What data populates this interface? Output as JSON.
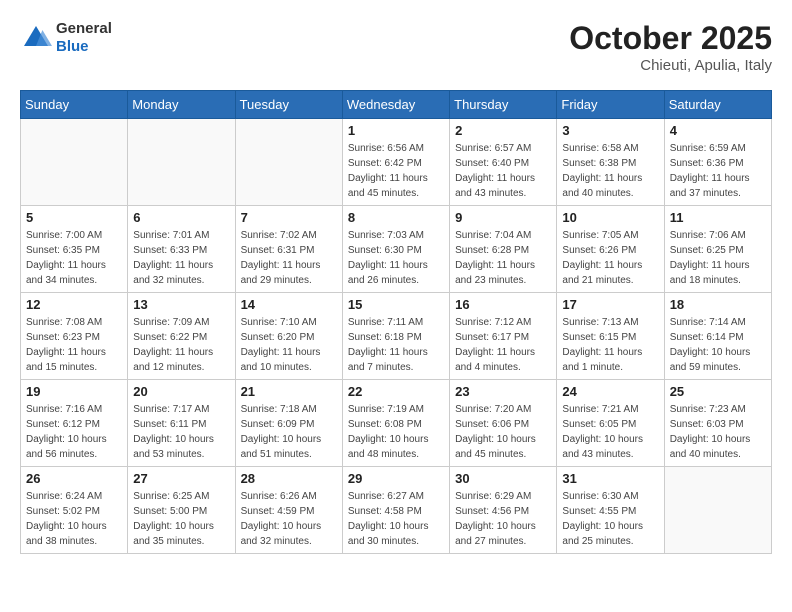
{
  "header": {
    "logo_general": "General",
    "logo_blue": "Blue",
    "month_year": "October 2025",
    "location": "Chieuti, Apulia, Italy"
  },
  "weekdays": [
    "Sunday",
    "Monday",
    "Tuesday",
    "Wednesday",
    "Thursday",
    "Friday",
    "Saturday"
  ],
  "weeks": [
    [
      {
        "day": "",
        "info": ""
      },
      {
        "day": "",
        "info": ""
      },
      {
        "day": "",
        "info": ""
      },
      {
        "day": "1",
        "info": "Sunrise: 6:56 AM\nSunset: 6:42 PM\nDaylight: 11 hours\nand 45 minutes."
      },
      {
        "day": "2",
        "info": "Sunrise: 6:57 AM\nSunset: 6:40 PM\nDaylight: 11 hours\nand 43 minutes."
      },
      {
        "day": "3",
        "info": "Sunrise: 6:58 AM\nSunset: 6:38 PM\nDaylight: 11 hours\nand 40 minutes."
      },
      {
        "day": "4",
        "info": "Sunrise: 6:59 AM\nSunset: 6:36 PM\nDaylight: 11 hours\nand 37 minutes."
      }
    ],
    [
      {
        "day": "5",
        "info": "Sunrise: 7:00 AM\nSunset: 6:35 PM\nDaylight: 11 hours\nand 34 minutes."
      },
      {
        "day": "6",
        "info": "Sunrise: 7:01 AM\nSunset: 6:33 PM\nDaylight: 11 hours\nand 32 minutes."
      },
      {
        "day": "7",
        "info": "Sunrise: 7:02 AM\nSunset: 6:31 PM\nDaylight: 11 hours\nand 29 minutes."
      },
      {
        "day": "8",
        "info": "Sunrise: 7:03 AM\nSunset: 6:30 PM\nDaylight: 11 hours\nand 26 minutes."
      },
      {
        "day": "9",
        "info": "Sunrise: 7:04 AM\nSunset: 6:28 PM\nDaylight: 11 hours\nand 23 minutes."
      },
      {
        "day": "10",
        "info": "Sunrise: 7:05 AM\nSunset: 6:26 PM\nDaylight: 11 hours\nand 21 minutes."
      },
      {
        "day": "11",
        "info": "Sunrise: 7:06 AM\nSunset: 6:25 PM\nDaylight: 11 hours\nand 18 minutes."
      }
    ],
    [
      {
        "day": "12",
        "info": "Sunrise: 7:08 AM\nSunset: 6:23 PM\nDaylight: 11 hours\nand 15 minutes."
      },
      {
        "day": "13",
        "info": "Sunrise: 7:09 AM\nSunset: 6:22 PM\nDaylight: 11 hours\nand 12 minutes."
      },
      {
        "day": "14",
        "info": "Sunrise: 7:10 AM\nSunset: 6:20 PM\nDaylight: 11 hours\nand 10 minutes."
      },
      {
        "day": "15",
        "info": "Sunrise: 7:11 AM\nSunset: 6:18 PM\nDaylight: 11 hours\nand 7 minutes."
      },
      {
        "day": "16",
        "info": "Sunrise: 7:12 AM\nSunset: 6:17 PM\nDaylight: 11 hours\nand 4 minutes."
      },
      {
        "day": "17",
        "info": "Sunrise: 7:13 AM\nSunset: 6:15 PM\nDaylight: 11 hours\nand 1 minute."
      },
      {
        "day": "18",
        "info": "Sunrise: 7:14 AM\nSunset: 6:14 PM\nDaylight: 10 hours\nand 59 minutes."
      }
    ],
    [
      {
        "day": "19",
        "info": "Sunrise: 7:16 AM\nSunset: 6:12 PM\nDaylight: 10 hours\nand 56 minutes."
      },
      {
        "day": "20",
        "info": "Sunrise: 7:17 AM\nSunset: 6:11 PM\nDaylight: 10 hours\nand 53 minutes."
      },
      {
        "day": "21",
        "info": "Sunrise: 7:18 AM\nSunset: 6:09 PM\nDaylight: 10 hours\nand 51 minutes."
      },
      {
        "day": "22",
        "info": "Sunrise: 7:19 AM\nSunset: 6:08 PM\nDaylight: 10 hours\nand 48 minutes."
      },
      {
        "day": "23",
        "info": "Sunrise: 7:20 AM\nSunset: 6:06 PM\nDaylight: 10 hours\nand 45 minutes."
      },
      {
        "day": "24",
        "info": "Sunrise: 7:21 AM\nSunset: 6:05 PM\nDaylight: 10 hours\nand 43 minutes."
      },
      {
        "day": "25",
        "info": "Sunrise: 7:23 AM\nSunset: 6:03 PM\nDaylight: 10 hours\nand 40 minutes."
      }
    ],
    [
      {
        "day": "26",
        "info": "Sunrise: 6:24 AM\nSunset: 5:02 PM\nDaylight: 10 hours\nand 38 minutes."
      },
      {
        "day": "27",
        "info": "Sunrise: 6:25 AM\nSunset: 5:00 PM\nDaylight: 10 hours\nand 35 minutes."
      },
      {
        "day": "28",
        "info": "Sunrise: 6:26 AM\nSunset: 4:59 PM\nDaylight: 10 hours\nand 32 minutes."
      },
      {
        "day": "29",
        "info": "Sunrise: 6:27 AM\nSunset: 4:58 PM\nDaylight: 10 hours\nand 30 minutes."
      },
      {
        "day": "30",
        "info": "Sunrise: 6:29 AM\nSunset: 4:56 PM\nDaylight: 10 hours\nand 27 minutes."
      },
      {
        "day": "31",
        "info": "Sunrise: 6:30 AM\nSunset: 4:55 PM\nDaylight: 10 hours\nand 25 minutes."
      },
      {
        "day": "",
        "info": ""
      }
    ]
  ]
}
